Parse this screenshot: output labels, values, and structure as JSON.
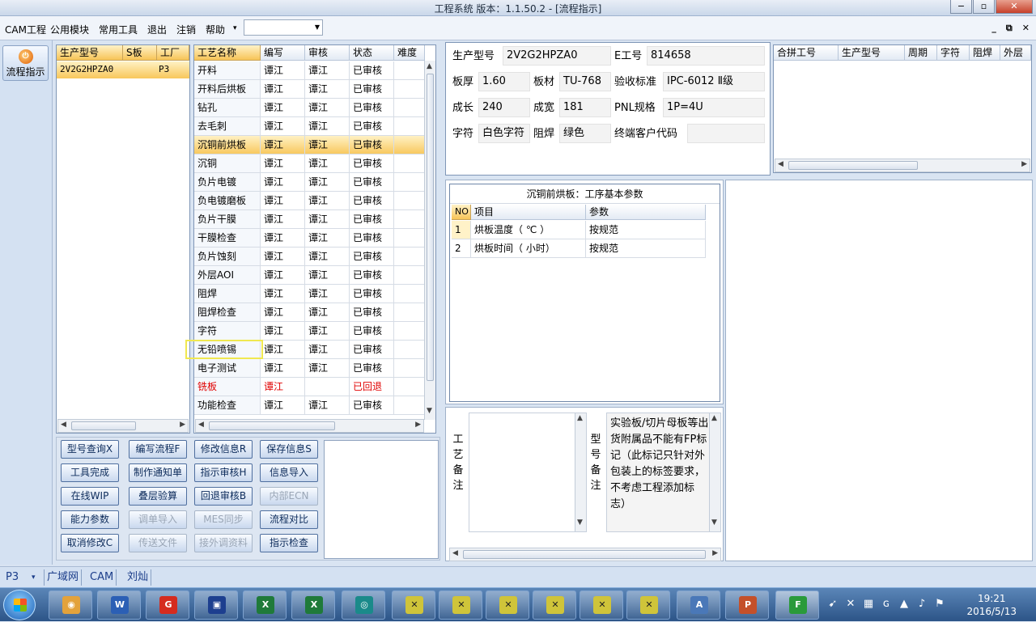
{
  "window": {
    "title": "工程系统   版本：1.1.50.2 - [流程指示]",
    "min": "−",
    "max": "▫",
    "close": "✕"
  },
  "menu": {
    "items": [
      "CAM工程",
      "公用模块",
      "常用工具",
      "退出",
      "注销",
      "帮助"
    ],
    "help_arrow": "▾",
    "combo_value": "",
    "mdi": [
      "_",
      "⧉",
      "✕"
    ]
  },
  "leftbar": {
    "flow_label": "流程指示"
  },
  "partlist": {
    "headers": [
      "生产型号",
      "S板",
      "工厂"
    ],
    "rows": [
      [
        "2V2G2HPZA0",
        "",
        "P3"
      ]
    ]
  },
  "process": {
    "headers": [
      "工艺名称",
      "编写",
      "审核",
      "状态",
      "难度"
    ],
    "rows": [
      [
        "开料",
        "谭江",
        "谭江",
        "已审核",
        ""
      ],
      [
        "开料后烘板",
        "谭江",
        "谭江",
        "已审核",
        ""
      ],
      [
        "钻孔",
        "谭江",
        "谭江",
        "已审核",
        ""
      ],
      [
        "去毛刺",
        "谭江",
        "谭江",
        "已审核",
        ""
      ],
      [
        "沉铜前烘板",
        "谭江",
        "谭江",
        "已审核",
        ""
      ],
      [
        "沉铜",
        "谭江",
        "谭江",
        "已审核",
        ""
      ],
      [
        "负片电镀",
        "谭江",
        "谭江",
        "已审核",
        ""
      ],
      [
        "负电镀磨板",
        "谭江",
        "谭江",
        "已审核",
        ""
      ],
      [
        "负片干膜",
        "谭江",
        "谭江",
        "已审核",
        ""
      ],
      [
        "干膜检查",
        "谭江",
        "谭江",
        "已审核",
        ""
      ],
      [
        "负片蚀刻",
        "谭江",
        "谭江",
        "已审核",
        ""
      ],
      [
        "外层AOI",
        "谭江",
        "谭江",
        "已审核",
        ""
      ],
      [
        "阻焊",
        "谭江",
        "谭江",
        "已审核",
        ""
      ],
      [
        "阻焊检查",
        "谭江",
        "谭江",
        "已审核",
        ""
      ],
      [
        "字符",
        "谭江",
        "谭江",
        "已审核",
        ""
      ],
      [
        "无铅喷锡",
        "谭江",
        "谭江",
        "已审核",
        ""
      ],
      [
        "电子测试",
        "谭江",
        "谭江",
        "已审核",
        ""
      ],
      [
        "铣板",
        "谭江",
        "",
        "已回退",
        ""
      ],
      [
        "功能检查",
        "谭江",
        "谭江",
        "已审核",
        ""
      ]
    ],
    "selected_index": 4,
    "rejected_index": 17
  },
  "buttons": [
    [
      "型号查询X",
      "编写流程F",
      "修改信息R",
      "保存信息S"
    ],
    [
      "工具完成",
      "制作通知单",
      "指示审核H",
      "信息导入"
    ],
    [
      "在线WIP",
      "叠层验算",
      "回退审核B",
      "内部ECN"
    ],
    [
      "能力参数",
      "调单导入",
      "MES同步",
      "流程对比"
    ],
    [
      "取消修改C",
      "传送文件",
      "接外调资料",
      "指示检查"
    ]
  ],
  "disabled_buttons": [
    "内部ECN",
    "调单导入",
    "MES同步",
    "传送文件",
    "接外调资料"
  ],
  "info": {
    "part_no_label": "生产型号",
    "part_no": "2V2G2HPZA0",
    "eno_label": "E工号",
    "eno": "814658",
    "thick_label": "板厚",
    "thick": "1.60",
    "material_label": "板材",
    "material": "TU-768",
    "std_label": "验收标准",
    "std": "IPC-6012 Ⅱ级",
    "len_label": "成长",
    "len": "240",
    "wid_label": "成宽",
    "wid": "181",
    "pnl_label": "PNL规格",
    "pnl": "1P=4U",
    "char_label": "字符",
    "char": "白色字符",
    "mask_label": "阻焊",
    "mask": "绿色",
    "cust_label": "终端客户代码",
    "cust": ""
  },
  "merge": {
    "headers": [
      "合拼工号",
      "生产型号",
      "周期",
      "字符",
      "阻焊",
      "外层"
    ]
  },
  "params": {
    "title": "沉铜前烘板：工序基本参数",
    "headers": [
      "NO",
      "项目",
      "参数"
    ],
    "rows": [
      [
        "1",
        "烘板温度（ ℃ ）",
        "按规范"
      ],
      [
        "2",
        "烘板时间（ 小时）",
        "按规范"
      ]
    ]
  },
  "remarks": {
    "process_label": "工艺备注",
    "process_text": "",
    "model_label": "型号备注",
    "model_text": "实验板/切片母板等出货附属品不能有FP标记（此标记只针对外包装上的标签要求，不考虑工程添加标志）"
  },
  "status": {
    "factory": "P3",
    "arrow": "▾",
    "items": [
      "广域网",
      "CAM",
      "刘灿"
    ]
  },
  "taskbar": {
    "time": "19:21",
    "date": "2016/5/13"
  }
}
